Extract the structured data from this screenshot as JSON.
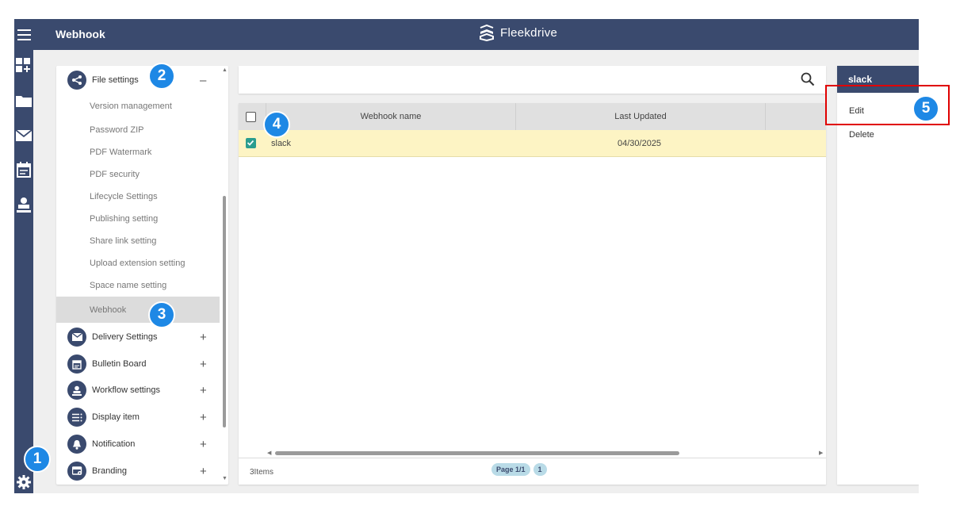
{
  "header": {
    "title": "Webhook",
    "brand": "Fleekdrive"
  },
  "rail": {
    "icons": [
      "menu-icon",
      "dashboard-icon",
      "folder-icon",
      "mail-icon",
      "calendar-icon",
      "workflow-icon",
      "gear-icon"
    ]
  },
  "nav": {
    "groups": [
      {
        "label": "File settings",
        "toggle": "–",
        "icon": "share-icon"
      },
      {
        "label": "Delivery Settings",
        "toggle": "+",
        "icon": "mail-icon"
      },
      {
        "label": "Bulletin Board",
        "toggle": "+",
        "icon": "bulletin-icon"
      },
      {
        "label": "Workflow settings",
        "toggle": "+",
        "icon": "workflow-icon"
      },
      {
        "label": "Display item",
        "toggle": "+",
        "icon": "list-icon"
      },
      {
        "label": "Notification",
        "toggle": "+",
        "icon": "bell-icon"
      },
      {
        "label": "Branding",
        "toggle": "+",
        "icon": "branding-icon"
      }
    ],
    "file_settings_items": [
      "Version management",
      "Password ZIP",
      "PDF Watermark",
      "PDF security",
      "Lifecycle Settings",
      "Publishing setting",
      "Share link setting",
      "Upload extension setting",
      "Space name setting",
      "Webhook"
    ],
    "active_item": "Webhook"
  },
  "search": {
    "placeholder": ""
  },
  "grid": {
    "columns": [
      "Webhook name",
      "Last Updated"
    ],
    "rows": [
      {
        "name": "slack",
        "last_updated": "04/30/2025",
        "checked": true
      }
    ],
    "footer": {
      "items_count": "3Items",
      "page_label": "Page 1/1",
      "page_number": "1"
    }
  },
  "context_menu": {
    "title": "slack",
    "items": [
      "Edit",
      "Delete"
    ]
  },
  "annotations": [
    "1",
    "2",
    "3",
    "4",
    "5"
  ],
  "colors": {
    "primary": "#3a4a6e",
    "selected_row": "#fdf4c4",
    "checkbox": "#2a9d8f",
    "badge": "#1e88e5",
    "highlight": "#e00000"
  }
}
